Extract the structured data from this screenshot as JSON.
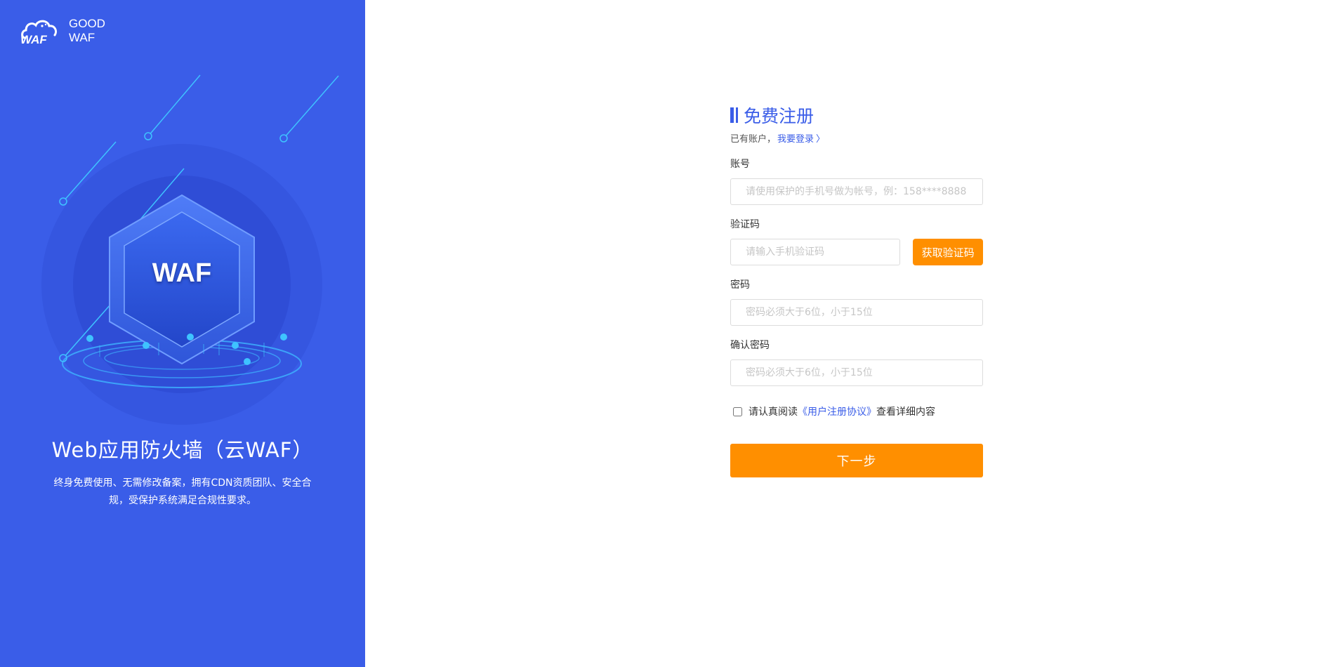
{
  "brand": {
    "logo_line1": "GOOD",
    "logo_line2": "WAF",
    "hex_label": "WAF",
    "title": "Web应用防火墙（云WAF）",
    "description": "终身免费使用、无需修改备案，拥有CDN资质团队、安全合规，受保护系统满足合规性要求。",
    "panel_color": "#3a5de8",
    "logo_icon": "cloud-waf-logo-icon",
    "illustration_icon": "hexagon-waf-shield-icon"
  },
  "form": {
    "heading": "免费注册",
    "has_account_text": "已有账户，",
    "login_link": "我要登录",
    "login_chevron": "〉",
    "account_label": "账号",
    "account_placeholder": "请使用保护的手机号做为帐号，例：158****8888",
    "code_label": "验证码",
    "code_placeholder": "请输入手机验证码",
    "get_code_button": "获取验证码",
    "password_label": "密码",
    "password_placeholder": "密码必须大于6位，小于15位",
    "confirm_label": "确认密码",
    "confirm_placeholder": "密码必须大于6位，小于15位",
    "agree_prefix": "请认真阅读",
    "agreement_link": "《用户注册协议》",
    "agree_suffix": "查看详细内容",
    "agree_checked": false,
    "next_button": "下一步",
    "accent_color": "#3a5de8",
    "button_color": "#ff8f00"
  }
}
